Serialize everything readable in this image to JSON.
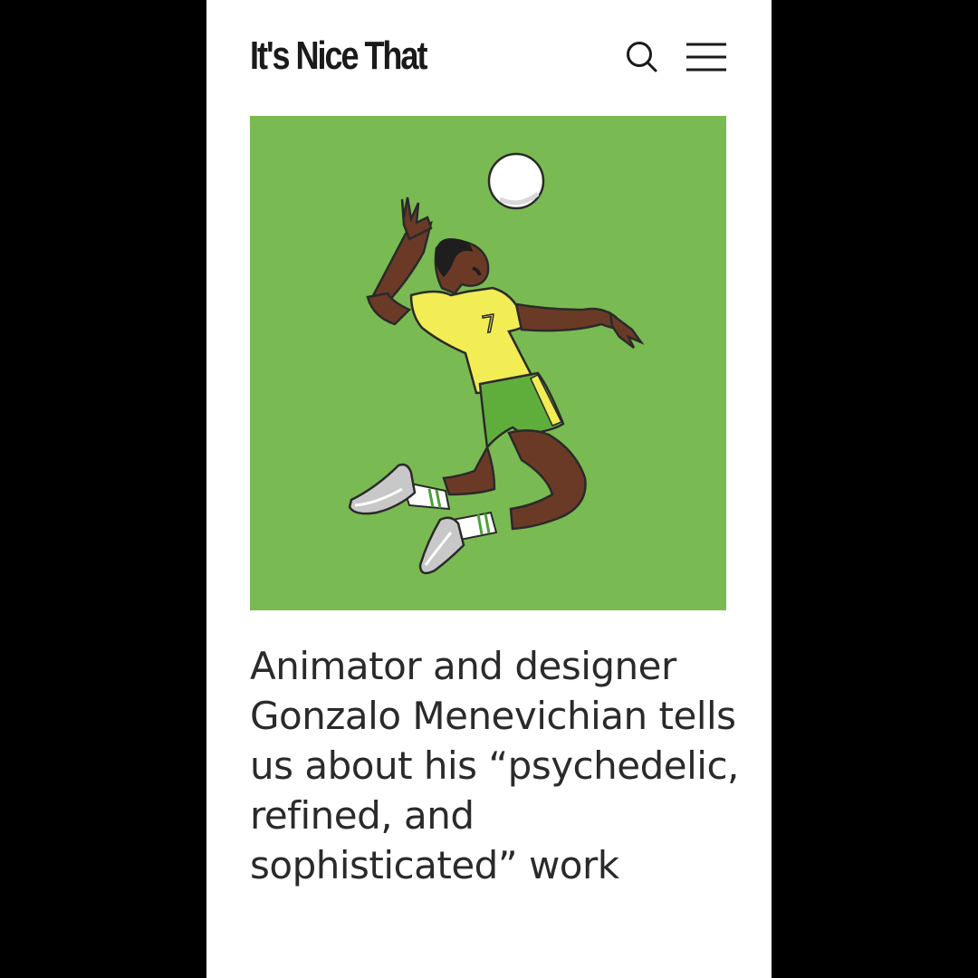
{
  "site": {
    "logo_text": "It's Nice That"
  },
  "header": {
    "search_icon": "search-icon",
    "menu_icon": "hamburger-menu-icon"
  },
  "hero": {
    "background_color": "#7aba52",
    "jersey_number": "7"
  },
  "article": {
    "headline": "Animator and designer Gonzalo Menevichian tells us about his “psychedelic, refined, and sophisticated” work"
  },
  "colors": {
    "page_bg": "#ffffff",
    "outer_bg": "#000000",
    "text": "#2a2a2a"
  }
}
